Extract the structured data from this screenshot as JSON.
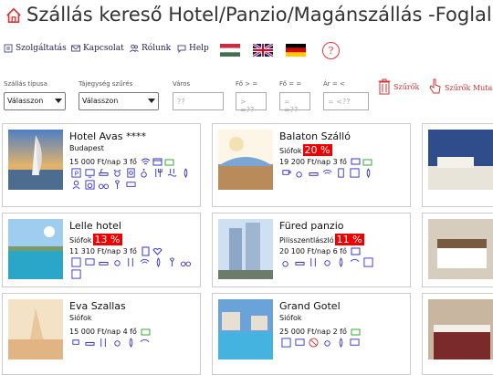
{
  "header": {
    "title": "Szállás kereső Hotel/Panzio/Magánszállás -Foglalás"
  },
  "nav": {
    "services": "Szolgáltatás",
    "contact": "Kapcsolat",
    "about": "Rólunk",
    "help": "Help",
    "help_symbol": "?"
  },
  "flags": [
    "hungary-flag",
    "uk-flag",
    "germany-flag"
  ],
  "filters": {
    "type_label": "Szállás típusa",
    "type_value": "Válasszon",
    "region_label": "Tájegység szűrés",
    "region_value": "Válasszon",
    "city_label": "Város",
    "city_placeholder": "??",
    "fo_ge_label": "Fő > =",
    "fo_ge_placeholder": "> =??",
    "fo_eq_label": "Fő = =",
    "fo_eq_placeholder": "= =??",
    "price_label": "Ár = <",
    "price_placeholder": "= <??",
    "filter_button": "Szűrők",
    "show_filter_button": "Szűrők Mutat"
  },
  "colors": {
    "accent": "#e03030",
    "icon_blue": "#3a3ad0",
    "badge": "#ee0000"
  },
  "cards": [
    {
      "name": "Hotel Avas ****",
      "city": "Budapest",
      "badge": "",
      "price": "15 000 Ft/nap 3 fő"
    },
    {
      "name": "Balaton Szálló",
      "city": "Siófok",
      "badge": "20 %",
      "price": "19 200 Ft/nap 3 fő"
    },
    {
      "name": "Lelle hotel",
      "city": "Siófok",
      "badge": "13 %",
      "price": "11 310 Ft/nap 3 fő"
    },
    {
      "name": "Füred panzio",
      "city": "Pilisszentlászló",
      "badge": "11 %",
      "price": "20 100 Ft/nap 6 fő"
    },
    {
      "name": "Eva Szallas",
      "city": "Siófok",
      "badge": "",
      "price": "15 000 Ft/nap 4 fő"
    },
    {
      "name": "Grand Gotel",
      "city": "Siófok",
      "badge": "",
      "price": "25 000 Ft/nap 2 fő"
    }
  ]
}
